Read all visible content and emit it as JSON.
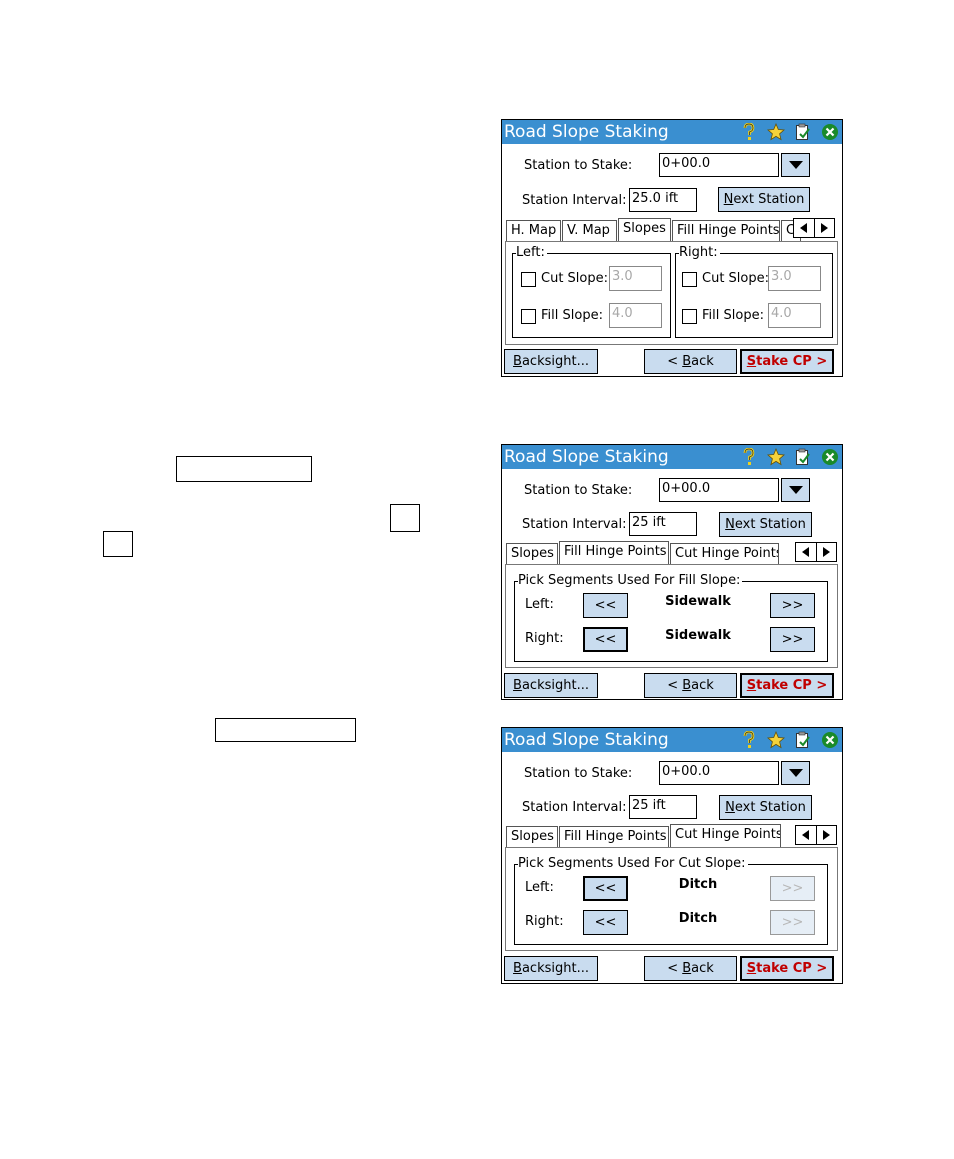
{
  "app": {
    "title": "Road Slope Staking"
  },
  "screen1": {
    "station_to_stake_label": "Station to Stake:",
    "station_to_stake_value": "0+00.0",
    "station_interval_label": "Station Interval:",
    "station_interval_value": "25.0 ift",
    "next_station_label": "Next Station",
    "tabs": [
      "H. Map",
      "V. Map",
      "Slopes",
      "Fill Hinge Points",
      "C"
    ],
    "active_tab": "Slopes",
    "left_group": "Left:",
    "right_group": "Right:",
    "cut_slope_label": "Cut Slope:",
    "fill_slope_label": "Fill Slope:",
    "left_cut_value": "3.0",
    "left_fill_value": "4.0",
    "right_cut_value": "3.0",
    "right_fill_value": "4.0",
    "backsight_label": "Backsight...",
    "back_label": "< Back",
    "stake_label": "Stake CP >"
  },
  "screen2": {
    "station_to_stake_label": "Station to Stake:",
    "station_to_stake_value": "0+00.0",
    "station_interval_label": "Station Interval:",
    "station_interval_value": "25 ift",
    "next_station_label": "Next Station",
    "tabs": [
      "Slopes",
      "Fill Hinge Points",
      "Cut Hinge Points"
    ],
    "active_tab": "Fill Hinge Points",
    "group_title": "Pick Segments Used For Fill Slope:",
    "left_label": "Left:",
    "right_label": "Right:",
    "left_segment": "Sidewalk",
    "right_segment": "Sidewalk",
    "prev_label": "<<",
    "next_label": ">>",
    "backsight_label": "Backsight...",
    "back_label": "< Back",
    "stake_label": "Stake CP >"
  },
  "screen3": {
    "station_to_stake_label": "Station to Stake:",
    "station_to_stake_value": "0+00.0",
    "station_interval_label": "Station Interval:",
    "station_interval_value": "25 ift",
    "next_station_label": "Next Station",
    "tabs": [
      "Slopes",
      "Fill Hinge Points",
      "Cut Hinge Points"
    ],
    "active_tab": "Cut Hinge Points",
    "group_title": "Pick Segments Used For Cut Slope:",
    "left_label": "Left:",
    "right_label": "Right:",
    "left_segment": "Ditch",
    "right_segment": "Ditch",
    "prev_label": "<<",
    "next_label": ">>",
    "backsight_label": "Backsight...",
    "back_label": "< Back",
    "stake_label": "Stake CP >"
  },
  "icons": [
    "help-icon",
    "favorites-star-icon",
    "clipboard-check-icon",
    "close-icon",
    "dropdown-arrow-icon",
    "tab-scroll-left-icon",
    "tab-scroll-right-icon"
  ],
  "colors": {
    "titlebar": "#3a8fd0",
    "button_face": "#c9dcef",
    "stake_text": "#c00000",
    "close_green": "#1a8a2a"
  }
}
